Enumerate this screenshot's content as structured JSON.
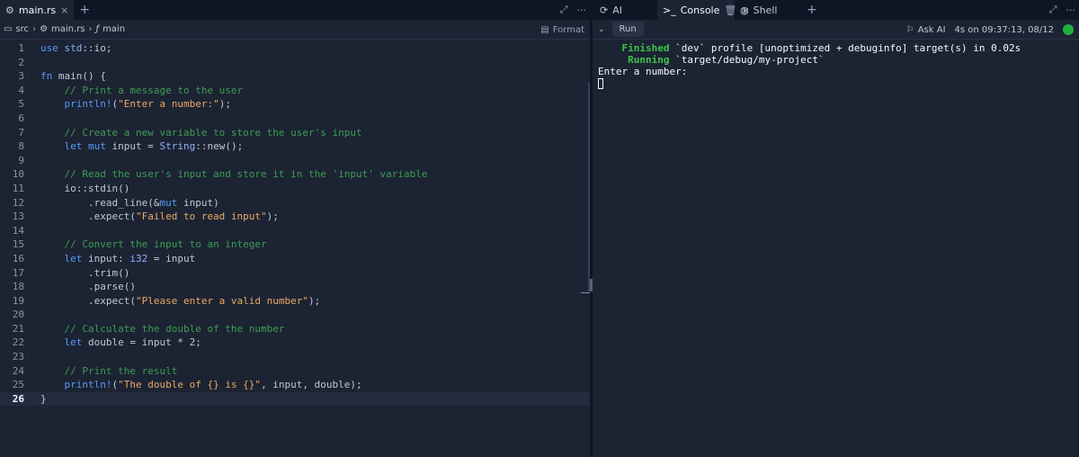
{
  "editor_tabs": {
    "file": "main.rs",
    "close": "×",
    "add": "+"
  },
  "editor_actions": {
    "expand": "⤢",
    "more": "···"
  },
  "breadcrumb": {
    "folder": "src",
    "file": "main.rs",
    "symbol": "main",
    "format_label": "Format"
  },
  "code_lines": [
    "1",
    "2",
    "3",
    "4",
    "5",
    "6",
    "7",
    "8",
    "9",
    "10",
    "11",
    "12",
    "13",
    "14",
    "15",
    "16",
    "17",
    "18",
    "19",
    "20",
    "21",
    "22",
    "23",
    "24",
    "25",
    "26"
  ],
  "right_tabs": {
    "ai": "AI",
    "console": "Console",
    "shell": "Shell",
    "add": "+"
  },
  "console_toolbar": {
    "run": "Run",
    "ask_ai": "Ask AI",
    "status": "4s on 09:37:13, 08/12"
  },
  "console_output": {
    "finished_word": "Finished",
    "finished_rest": " `dev` profile [unoptimized + debuginfo] target(s) in 0.02s",
    "running_word": "Running",
    "running_rest": " `target/debug/my-project`",
    "prompt": "Enter a number:"
  },
  "colors": {
    "status_dot": "#1fb03c",
    "bg": "#1c2333",
    "tabbar_bg": "#0e1525"
  }
}
